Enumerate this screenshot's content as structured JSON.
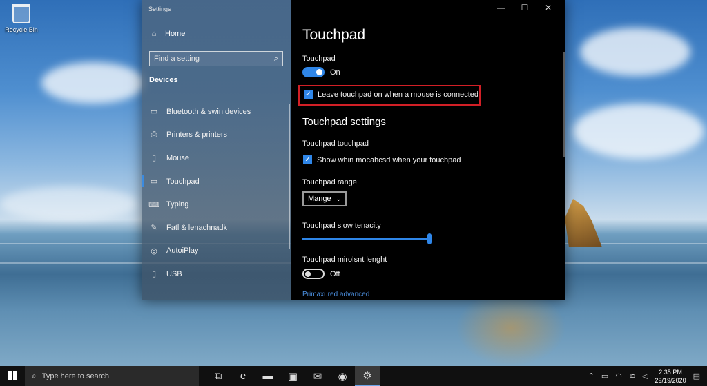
{
  "desktop": {
    "recycle_bin_label": "Recycle Bin"
  },
  "window": {
    "title": "Settings",
    "controls": {
      "minimize": "—",
      "maximize": "☐",
      "close": "✕"
    }
  },
  "sidebar": {
    "home_label": "Home",
    "search_placeholder": "Find a setting",
    "section_label": "Devices",
    "items": [
      {
        "label": "Bluetooth & swin devices",
        "icon": "bluetooth-icon",
        "glyph": "▭"
      },
      {
        "label": "Printers & printers",
        "icon": "printer-icon",
        "glyph": "⎙"
      },
      {
        "label": "Mouse",
        "icon": "mouse-icon",
        "glyph": "▯"
      },
      {
        "label": "Touchpad",
        "icon": "touchpad-icon",
        "glyph": "▭",
        "active": true
      },
      {
        "label": "Typing",
        "icon": "keyboard-icon",
        "glyph": "⌨"
      },
      {
        "label": "Fatl & lenachnadk",
        "icon": "pen-icon",
        "glyph": "✎"
      },
      {
        "label": "AutoiPlay",
        "icon": "autoplay-icon",
        "glyph": "◎"
      },
      {
        "label": "USB",
        "icon": "usb-icon",
        "glyph": "▯"
      }
    ]
  },
  "content": {
    "page_title": "Touchpad",
    "touchpad_label": "Touchpad",
    "touchpad_state": "On",
    "leave_on_label": "Leave touchpad on when a mouse is connected",
    "settings_heading": "Touchpad settings",
    "touchpad_touchpad_label": "Touchpad touchpad",
    "show_label": "Show whin mocahcsd when your touchpad",
    "range_label": "Touchpad range",
    "range_value": "Mange",
    "slow_label": "Touchpad slow tenacity",
    "slow_value": 0.98,
    "length_label": "Touchpad mirolsnt lenght",
    "length_state": "Off",
    "advanced_link": "Primaxured advanced"
  },
  "taskbar": {
    "search_placeholder": "Type here to search",
    "time": "2:35 PM",
    "date": "29/19/2020",
    "apps": [
      {
        "name": "task-view-icon",
        "glyph": "⧉"
      },
      {
        "name": "edge-icon",
        "glyph": "e"
      },
      {
        "name": "file-explorer-icon",
        "glyph": "▬"
      },
      {
        "name": "store-icon",
        "glyph": "▣"
      },
      {
        "name": "mail-icon",
        "glyph": "✉"
      },
      {
        "name": "chrome-icon",
        "glyph": "◉"
      },
      {
        "name": "settings-icon",
        "glyph": "⚙",
        "active": true
      }
    ]
  },
  "colors": {
    "accent": "#2f86e8",
    "highlight_box": "#d21f26"
  }
}
